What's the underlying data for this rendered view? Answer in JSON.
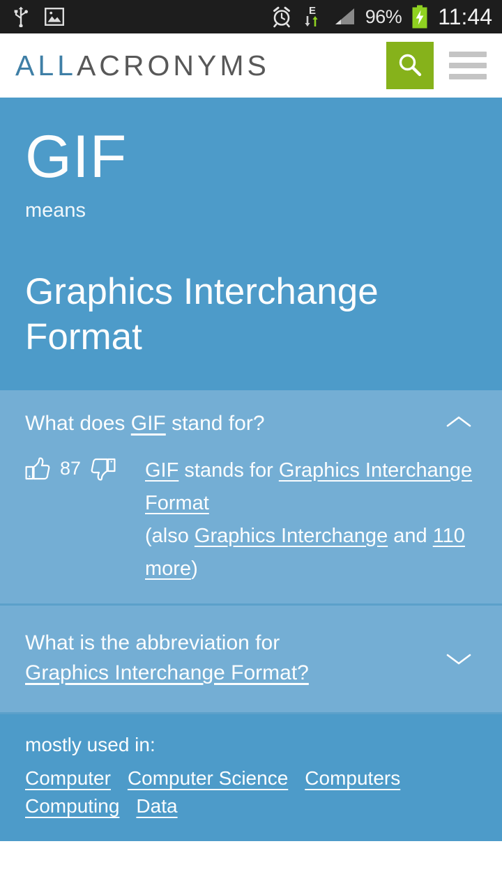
{
  "status_bar": {
    "icons_left": [
      "usb-icon",
      "gallery-icon"
    ],
    "alarm": "alarm-icon",
    "network_type": "E",
    "signal": "signal-icon",
    "battery_percent": "96%",
    "battery": "battery-charging-icon",
    "clock": "11:44"
  },
  "header": {
    "logo_part1": "ALL",
    "logo_part2": "ACRONYMS",
    "search_icon": "search-icon",
    "menu_icon": "hamburger-menu-icon"
  },
  "hero": {
    "acronym": "GIF",
    "means_label": "means",
    "expansion": "Graphics Interchange Format"
  },
  "accordion": [
    {
      "question_prefix": "What does ",
      "question_link": "GIF",
      "question_suffix": " stand for?",
      "chevron": "chevron-up-icon",
      "expanded": true,
      "thumbs_up_icon": "thumbs-up-icon",
      "thumbs_down_icon": "thumbs-down-icon",
      "vote_count": "87",
      "answer": {
        "link1": "GIF",
        "mid": " stands for ",
        "link2": "Graphics Interchange Format",
        "also_open": "(also ",
        "link3": "Graphics Interchange",
        "also_mid": " and ",
        "link4": "110 more",
        "also_close": ")"
      }
    },
    {
      "question_line1": "What is the abbreviation for",
      "question_link": "Graphics Interchange Format?",
      "chevron": "chevron-down-icon",
      "expanded": false
    }
  ],
  "tags_section": {
    "label": "mostly used in:",
    "tags": [
      "Computer",
      "Computer Science",
      "Computers",
      "Computing",
      "Data"
    ]
  },
  "colors": {
    "hero_blue": "#4d9bc9",
    "accordion_blue": "#74aed4",
    "divider_blue": "#5ba0ca",
    "search_green": "#86b21b",
    "logo_blue": "#3f7fa6",
    "logo_gray": "#585858",
    "status_bar_bg": "#1d1d1d",
    "battery_green": "#8fd121"
  }
}
